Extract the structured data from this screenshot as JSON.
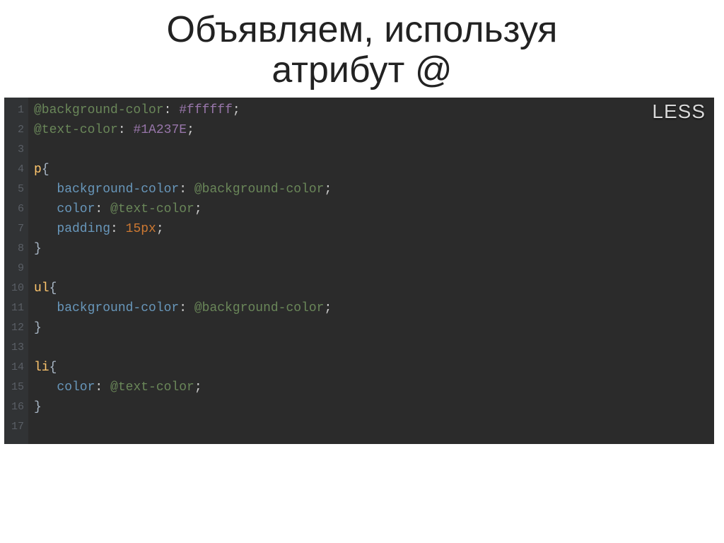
{
  "title_line1": "Объявляем, используя",
  "title_line2": "атрибут @",
  "badge": "LESS",
  "line_numbers": [
    "1",
    "2",
    "3",
    "4",
    "5",
    "6",
    "7",
    "8",
    "9",
    "10",
    "11",
    "12",
    "13",
    "14",
    "15",
    "16",
    "17"
  ],
  "code": {
    "l1": {
      "var": "@background-color",
      "colon": ":",
      "val": " #ffffff",
      "semi": ";"
    },
    "l2": {
      "var": "@text-color",
      "colon": ":",
      "val": " #1A237E",
      "semi": ";"
    },
    "l4": {
      "sel": "p",
      "brace": "{"
    },
    "l5": {
      "indent": "   ",
      "prop": "background-color",
      "colon": ":",
      "val": " @background-color",
      "semi": ";"
    },
    "l6": {
      "indent": "   ",
      "prop": "color",
      "colon": ":",
      "val": " @text-color",
      "semi": ";"
    },
    "l7": {
      "indent": "   ",
      "prop": "padding",
      "colon": ":",
      "val": " 15px",
      "semi": ";"
    },
    "l8": {
      "brace": "}"
    },
    "l10": {
      "sel": "ul",
      "brace": "{"
    },
    "l11": {
      "indent": "   ",
      "prop": "background-color",
      "colon": ":",
      "val": " @background-color",
      "semi": ";"
    },
    "l12": {
      "brace": "}"
    },
    "l14": {
      "sel": "li",
      "brace": "{"
    },
    "l15": {
      "indent": "   ",
      "prop": "color",
      "colon": ":",
      "val": " @text-color",
      "semi": ";"
    },
    "l16": {
      "brace": "}"
    }
  }
}
